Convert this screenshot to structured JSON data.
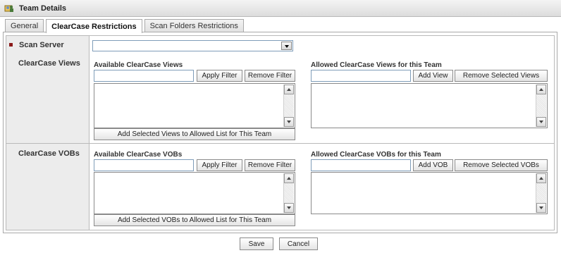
{
  "window": {
    "title": "Team Details",
    "title_icon": "team-icon"
  },
  "tabs": [
    {
      "label": "General",
      "active": false
    },
    {
      "label": "ClearCase Restrictions",
      "active": true
    },
    {
      "label": "Scan Folders Restrictions",
      "active": false
    }
  ],
  "scan_server": {
    "label": "Scan Server",
    "value": ""
  },
  "views": {
    "section_label": "ClearCase Views",
    "available": {
      "title": "Available ClearCase Views",
      "filter_value": "",
      "apply_filter_label": "Apply Filter",
      "remove_filter_label": "Remove Filter",
      "add_to_allowed_label": "Add Selected Views to Allowed List for This Team"
    },
    "allowed": {
      "title": "Allowed ClearCase Views for this Team",
      "input_value": "",
      "add_label": "Add View",
      "remove_selected_label": "Remove Selected Views"
    }
  },
  "vobs": {
    "section_label": "ClearCase VOBs",
    "available": {
      "title": "Available ClearCase VOBs",
      "filter_value": "",
      "apply_filter_label": "Apply Filter",
      "remove_filter_label": "Remove Filter",
      "add_to_allowed_label": "Add Selected VOBs to Allowed List for This Team"
    },
    "allowed": {
      "title": "Allowed ClearCase VOBs for this Team",
      "input_value": "",
      "add_label": "Add VOB",
      "remove_selected_label": "Remove Selected VOBs"
    }
  },
  "footer": {
    "save_label": "Save",
    "cancel_label": "Cancel"
  },
  "colors": {
    "required_marker": "#8b1a1a",
    "side_panel": "#ececec",
    "input_border": "#7f9db9"
  }
}
